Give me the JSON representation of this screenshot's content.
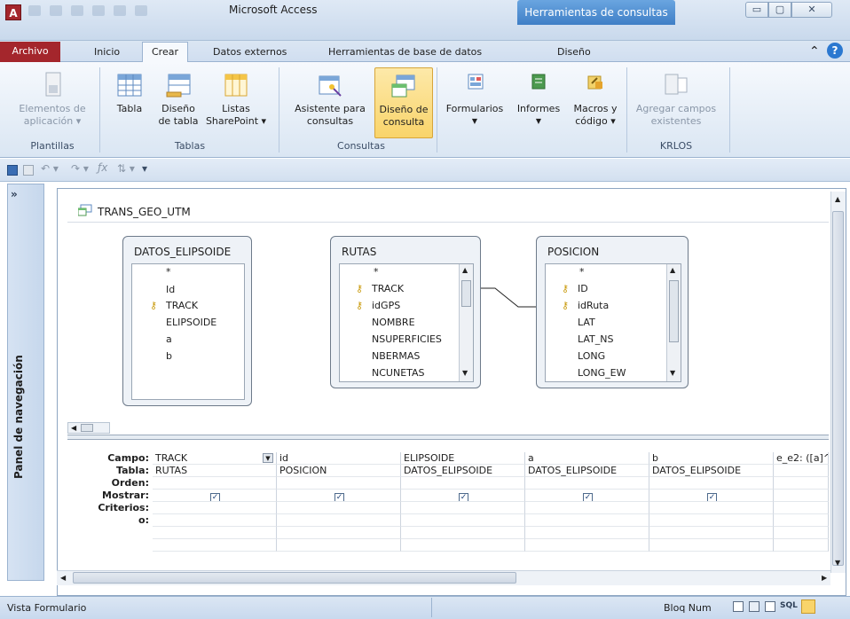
{
  "title": "Microsoft Access",
  "context_tab": "Herramientas de consultas",
  "window_controls": {
    "min": "▭",
    "max": "▢",
    "close": "✕"
  },
  "tabs": {
    "archivo": "Archivo",
    "inicio": "Inicio",
    "crear": "Crear",
    "datos_externos": "Datos externos",
    "herramientas_bd": "Herramientas de base de datos",
    "diseno": "Diseño"
  },
  "ribbon": {
    "plantillas": {
      "label": "Plantillas",
      "elementos_line1": "Elementos de",
      "elementos_line2": "aplicación ▾"
    },
    "tablas": {
      "label": "Tablas",
      "tabla": "Tabla",
      "diseno_line1": "Diseño",
      "diseno_line2": "de tabla",
      "listas_line1": "Listas",
      "listas_line2": "SharePoint ▾"
    },
    "consultas": {
      "label": "Consultas",
      "asistente_line1": "Asistente para",
      "asistente_line2": "consultas",
      "diseno_line1": "Diseño de",
      "diseno_line2": "consulta"
    },
    "formularios": "Formularios",
    "informes": "Informes",
    "macros_line1": "Macros y",
    "macros_line2": "código ▾",
    "krlos": {
      "label": "KRLOS",
      "agregar_line1": "Agregar campos",
      "agregar_line2": "existentes"
    }
  },
  "nav_pane": {
    "toggle": "»",
    "label": "Panel de navegación"
  },
  "query": {
    "title": "TRANS_GEO_UTM",
    "tables": [
      {
        "name": "DATOS_ELIPSOIDE",
        "fields": [
          "*",
          "Id",
          "TRACK",
          "ELIPSOIDE",
          "a",
          "b"
        ]
      },
      {
        "name": "RUTAS",
        "fields": [
          "*",
          "TRACK",
          "idGPS",
          "NOMBRE",
          "NSUPERFICIES",
          "NBERMAS",
          "NCUNETAS"
        ]
      },
      {
        "name": "POSICION",
        "fields": [
          "*",
          "ID",
          "idRuta",
          "LAT",
          "LAT_NS",
          "LONG",
          "LONG_EW"
        ]
      }
    ],
    "row_labels": [
      "Campo:",
      "Tabla:",
      "Orden:",
      "Mostrar:",
      "Criterios:",
      "o:"
    ],
    "columns": [
      {
        "campo": "TRACK",
        "tabla": "RUTAS"
      },
      {
        "campo": "id",
        "tabla": "POSICION"
      },
      {
        "campo": "ELIPSOIDE",
        "tabla": "DATOS_ELIPSOIDE"
      },
      {
        "campo": "a",
        "tabla": "DATOS_ELIPSOIDE"
      },
      {
        "campo": "b",
        "tabla": "DATOS_ELIPSOIDE"
      },
      {
        "campo": "e_e2: ([a]^",
        "tabla": ""
      }
    ]
  },
  "status": {
    "left": "Vista Formulario",
    "right": "Bloq Num",
    "sql": "SQL"
  }
}
